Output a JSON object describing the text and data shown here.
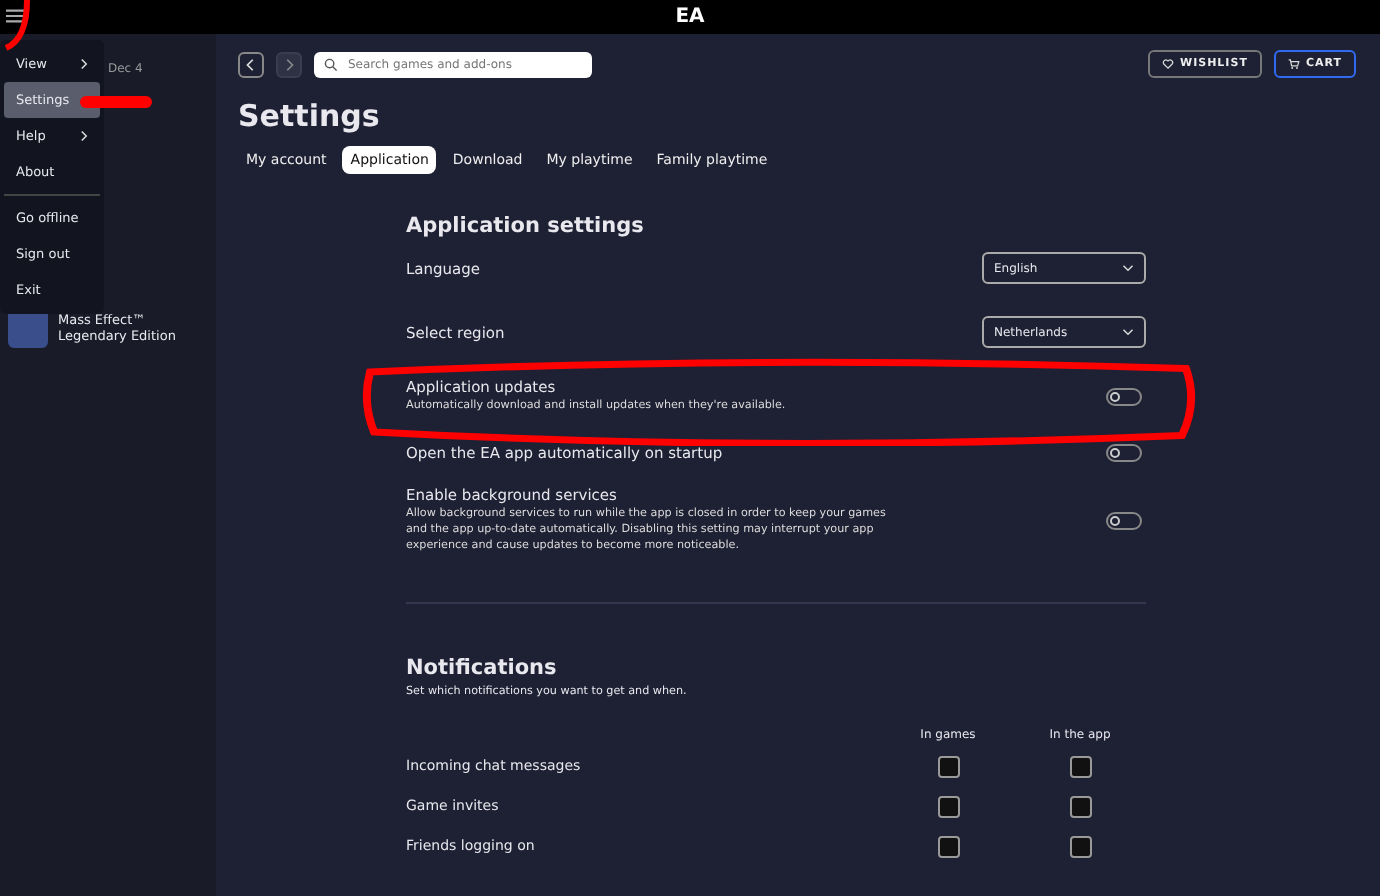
{
  "window": {
    "title": "EA"
  },
  "menu": {
    "items": [
      {
        "label": "View",
        "submenu": true,
        "selected": false
      },
      {
        "label": "Settings",
        "submenu": false,
        "selected": true
      },
      {
        "label": "Help",
        "submenu": true,
        "selected": false
      },
      {
        "label": "About",
        "submenu": false,
        "selected": false
      },
      {
        "label": "Go offline",
        "submenu": false,
        "selected": false,
        "divider_before": true
      },
      {
        "label": "Sign out",
        "submenu": false,
        "selected": false
      },
      {
        "label": "Exit",
        "submenu": false,
        "selected": false
      }
    ]
  },
  "sidebar": {
    "date": "Dec 4",
    "games": [
      {
        "title": "Mass Effect™ Legendary Edition"
      }
    ]
  },
  "toolbar": {
    "search": {
      "placeholder": "Search games and add-ons"
    },
    "wishlist": "WISHLIST",
    "cart": "CART"
  },
  "page_title": "Settings",
  "tabs": [
    {
      "label": "My account",
      "selected": false
    },
    {
      "label": "Application",
      "selected": true
    },
    {
      "label": "Download",
      "selected": false
    },
    {
      "label": "My playtime",
      "selected": false
    },
    {
      "label": "Family playtime",
      "selected": false
    }
  ],
  "application_settings": {
    "heading": "Application settings",
    "rows": [
      {
        "kind": "dropdown",
        "label": "Language",
        "value": "English"
      },
      {
        "kind": "dropdown",
        "label": "Select region",
        "value": "Netherlands"
      },
      {
        "kind": "toggle",
        "label": "Application updates",
        "description": "Automatically download and install updates when they're available.",
        "on": false,
        "highlighted": true
      },
      {
        "kind": "toggle",
        "label": "Open the EA app automatically on startup",
        "on": false,
        "highlighted": false
      },
      {
        "kind": "toggle",
        "label": "Enable background services",
        "description": "Allow background services to run while the app is closed in order to keep your games and the app up-to-date automatically. Disabling this setting may interrupt your app experience and cause updates to become more noticeable.",
        "on": false,
        "highlighted": false
      }
    ]
  },
  "notifications": {
    "heading": "Notifications",
    "subtitle": "Set which notifications you want to get and when.",
    "columns": [
      "In games",
      "In the app"
    ],
    "rows": [
      {
        "label": "Incoming chat messages",
        "in_games": false,
        "in_app": false
      },
      {
        "label": "Game invites",
        "in_games": false,
        "in_app": false
      },
      {
        "label": "Friends logging on",
        "in_games": false,
        "in_app": false
      }
    ]
  }
}
